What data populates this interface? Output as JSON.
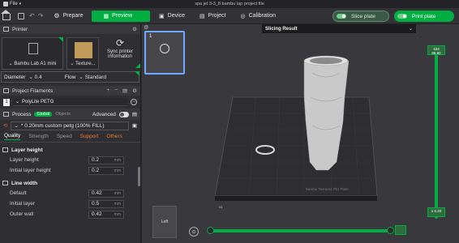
{
  "titlebar": {
    "file_menu": "File",
    "window_title": "spa jet 3-3_8 bambu lap project file"
  },
  "toolbar": {
    "tabs": [
      {
        "label": "Prepare"
      },
      {
        "label": "Preview"
      },
      {
        "label": "Device"
      },
      {
        "label": "Project"
      },
      {
        "label": "Calibration"
      }
    ],
    "slice_label": "Slice plate",
    "print_label": "Print plate"
  },
  "printer": {
    "section_title": "Printer",
    "name": "Bambu Lab A1 mini",
    "plate_label": "Texture...",
    "sync_label": "Sync printer information",
    "diameter_label": "Diameter",
    "diameter_value": "0.4",
    "flow_label": "Flow",
    "flow_value": "Standard"
  },
  "filaments": {
    "section_title": "Project Filaments",
    "items": [
      {
        "index": "1",
        "name": "PolyLite PETG"
      }
    ]
  },
  "process": {
    "title": "Process",
    "global_label": "Global",
    "objects_label": "Objects",
    "advanced_label": "Advanced",
    "preset": "* 0.20mm custom petg (100% FILL)",
    "tabs": [
      "Quality",
      "Strength",
      "Speed",
      "Support",
      "Others"
    ],
    "groups": [
      {
        "title": "Layer height",
        "rows": [
          {
            "label": "Layer height",
            "value": "0.2",
            "unit": "mm"
          },
          {
            "label": "Initial layer height",
            "value": "0.2",
            "unit": "mm"
          }
        ]
      },
      {
        "title": "Line width",
        "rows": [
          {
            "label": "Default",
            "value": "0.42",
            "unit": "mm"
          },
          {
            "label": "Initial layer",
            "value": "0.5",
            "unit": "mm"
          },
          {
            "label": "Outer wall",
            "value": "0.42",
            "unit": "mm"
          }
        ]
      }
    ]
  },
  "viewport": {
    "plate_number": "1",
    "slicing_result_title": "Slicing Result",
    "bed_text": "Bambu Textured PEI Plate",
    "top_layer_tag": "433\n86.60",
    "bottom_layer_tag": "1\n0.20",
    "view_label": "Left",
    "bed_index": "01"
  },
  "colors": {
    "accent": "#00ae42",
    "panel": "#2f2f33",
    "viewport": "#39393d"
  }
}
